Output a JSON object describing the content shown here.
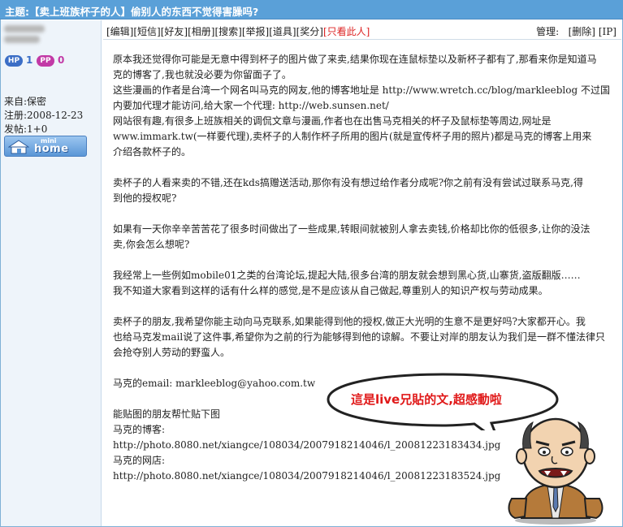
{
  "title": "主题:【卖上班族杯子的人】偷别人的东西不觉得害臊吗?",
  "sidebar": {
    "hp_label": "HP",
    "hp_value": "1",
    "pp_label": "PP",
    "pp_value": "0",
    "from": "来自:保密",
    "registered": "注册:2008-12-23",
    "posts": "发帖:1+0",
    "minihome_small": "mini",
    "minihome_big": "home"
  },
  "toolbar": {
    "links": [
      "[编辑]",
      "[短信]",
      "[好友]",
      "[相册]",
      "[搜索]",
      "[举报]",
      "[道具]",
      "[奖分]"
    ],
    "only_author": "[只看此人]",
    "admin_label": "管理:",
    "delete": "[删除]",
    "ip": "[IP]"
  },
  "post": {
    "para1": [
      "原本我还觉得你可能是无意中得到杯子的图片做了来卖,结果你现在连鼠标垫以及新杯子都有了,那看来你是知道马",
      "克的博客了,我也就没必要为你留面子了。",
      "这些漫画的作者是台湾一个网名叫马克的网友,他的博客地址是 http://www.wretch.cc/blog/markleeblog 不过国",
      "内要加代理才能访问,给大家一个代理: http://web.sunsen.net/",
      "网站很有趣,有很多上班族相关的调侃文章与漫画,作者也在出售马克相关的杯子及鼠标垫等周边,网址是",
      "www.immark.tw(一样要代理),卖杯子的人制作杯子所用的图片(就是宣传杯子用的照片)都是马克的博客上用来",
      "介绍各款杯子的。"
    ],
    "para2": [
      "卖杯子的人看来卖的不错,还在kds搞赠送活动,那你有没有想过给作者分成呢?你之前有没有尝试过联系马克,得",
      "到他的授权呢?"
    ],
    "para3": [
      "如果有一天你辛辛苦苦花了很多时间做出了一些成果,转眼间就被别人拿去卖钱,价格却比你的低很多,让你的没法",
      "卖,你会怎么想呢?"
    ],
    "para4": [
      "我经常上一些例如mobile01之类的台湾论坛,提起大陆,很多台湾的朋友就会想到黑心货,山寨货,盗版翻版……",
      "我不知道大家看到这样的话有什么样的感觉,是不是应该从自己做起,尊重别人的知识产权与劳动成果。"
    ],
    "para5": [
      "卖杯子的朋友,我希望你能主动向马克联系,如果能得到他的授权,做正大光明的生意不是更好吗?大家都开心。我",
      "也给马克发mail说了这件事,希望你为之前的行为能够得到他的谅解。不要让对岸的朋友认为我们是一群不懂法律只",
      "会抢夺别人劳动的野蛮人。"
    ],
    "email_line": "马克的email: markleeblog@yahoo.com.tw",
    "para7": [
      "能贴图的朋友帮忙贴下图",
      "马克的博客:",
      "http://photo.8080.net/xiangce/108034/2007918214046/l_20081223183434.jpg",
      "马克的网店:",
      "http://photo.8080.net/xiangce/108034/2007918214046/l_20081223183524.jpg"
    ]
  },
  "bubble_text": "這是live兄貼的文,超感動啦",
  "colors": {
    "title_bar": "#5aa0d8",
    "sidebar_bg": "#eef4fa",
    "hp": "#3b6ec6",
    "pp": "#c23aa6",
    "bubble_text": "#e01818",
    "only_author": "#d22222"
  }
}
